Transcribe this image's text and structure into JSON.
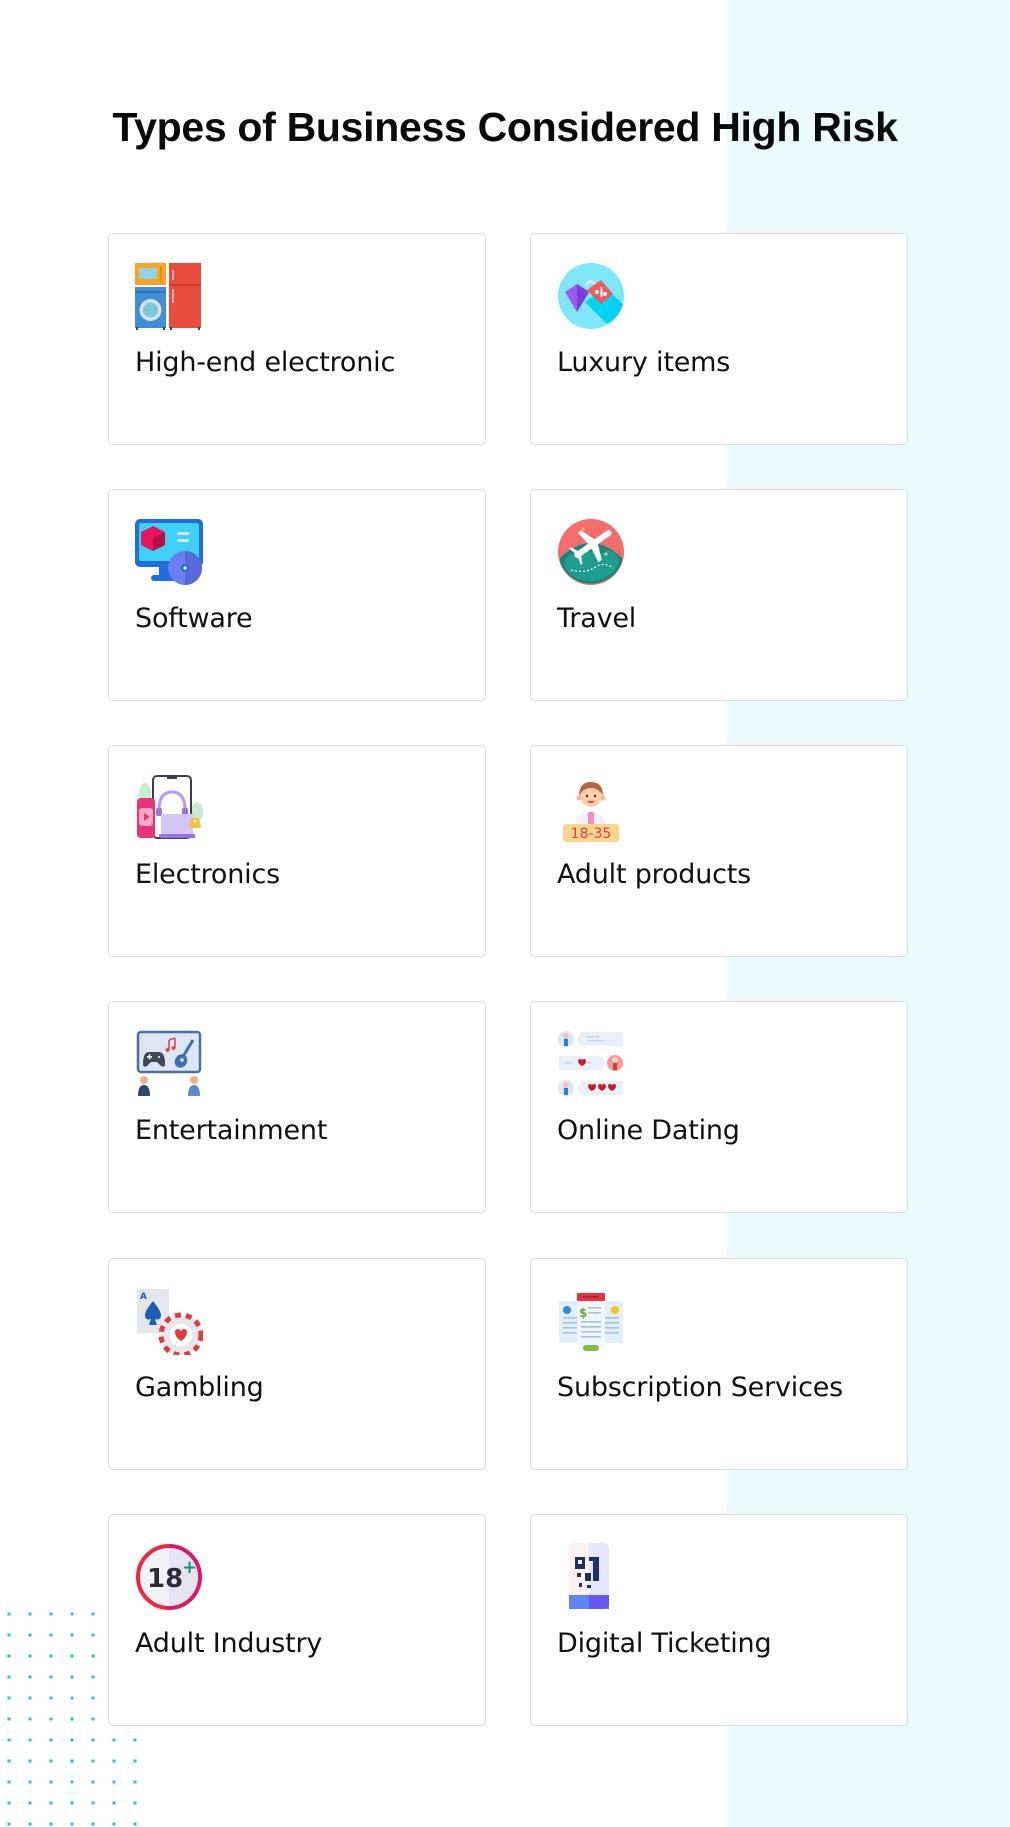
{
  "title": "Types of Business Considered High Risk",
  "colors": {
    "background": "#ffffff",
    "accent_band": "#ebfafd",
    "dot_pattern": "#1ec8d2",
    "card_border": "#dcdcdc",
    "title_text": "#0a0a0a"
  },
  "cards": [
    {
      "label": "High-end electronic",
      "icon": "appliances-icon"
    },
    {
      "label": "Luxury items",
      "icon": "diamond-tag-icon"
    },
    {
      "label": "Software",
      "icon": "computer-disc-icon"
    },
    {
      "label": "Travel",
      "icon": "globe-airplane-icon"
    },
    {
      "label": "Electronics",
      "icon": "devices-icon"
    },
    {
      "label": "Adult products",
      "icon": "age-18-35-icon"
    },
    {
      "label": "Entertainment",
      "icon": "game-music-screen-icon"
    },
    {
      "label": "Online Dating",
      "icon": "chat-hearts-icon"
    },
    {
      "label": "Gambling",
      "icon": "card-chip-icon"
    },
    {
      "label": "Subscription Services",
      "icon": "pricing-plans-icon"
    },
    {
      "label": "Adult Industry",
      "icon": "18-plus-icon"
    },
    {
      "label": "Digital Ticketing",
      "icon": "qr-ticket-icon"
    }
  ],
  "badges": {
    "age_range": "18-35",
    "age_limit": "18",
    "plus": "+",
    "ace": "A",
    "dollar": "$"
  }
}
